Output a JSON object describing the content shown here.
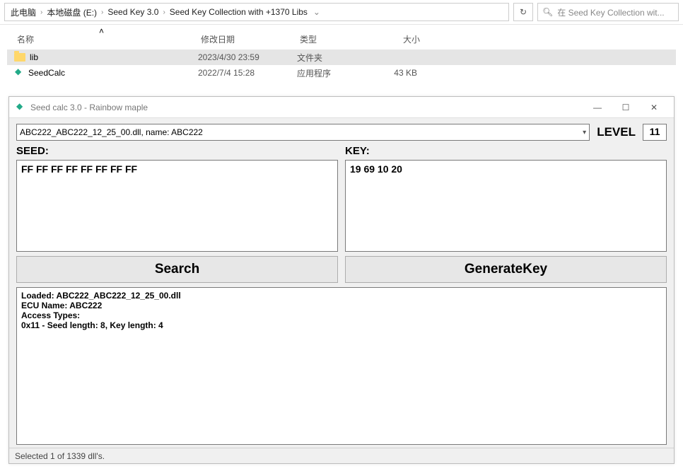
{
  "explorer": {
    "crumbs": [
      "此电脑",
      "本地磁盘 (E:)",
      "Seed Key 3.0",
      "Seed Key Collection with +1370 Libs"
    ],
    "search_placeholder": "在 Seed Key Collection wit...",
    "headers": {
      "name": "名称",
      "date": "修改日期",
      "type": "类型",
      "size": "大小"
    },
    "rows": [
      {
        "icon": "folder",
        "name": "lib",
        "date": "2023/4/30 23:59",
        "type": "文件夹",
        "size": "",
        "selected": true
      },
      {
        "icon": "app",
        "name": "SeedCalc",
        "date": "2022/7/4 15:28",
        "type": "应用程序",
        "size": "43 KB",
        "selected": false
      }
    ]
  },
  "app": {
    "title": "Seed calc 3.0 - Rainbow maple",
    "dll_selected": "ABC222_ABC222_12_25_00.dll, name: ABC222",
    "level_label": "LEVEL",
    "level_value": "11",
    "seed_label": "SEED:",
    "seed_value": "FF FF FF FF FF FF FF FF",
    "key_label": "KEY:",
    "key_value": "19 69 10 20",
    "search_btn": "Search",
    "generate_btn": "GenerateKey",
    "log": "Loaded: ABC222_ABC222_12_25_00.dll\nECU Name: ABC222\nAccess Types:\n0x11 - Seed length: 8, Key length: 4",
    "status": "Selected 1 of 1339 dll's."
  }
}
